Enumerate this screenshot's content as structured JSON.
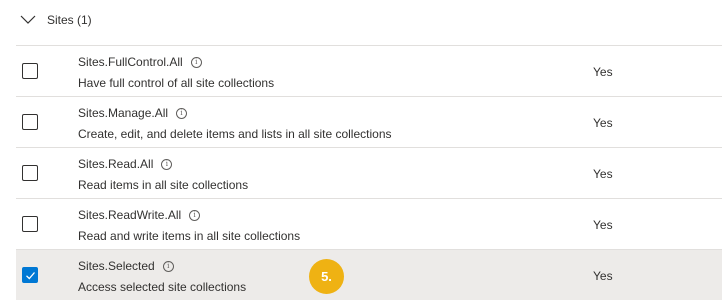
{
  "group": {
    "title": "Sites (1)"
  },
  "permissions": [
    {
      "name": "Sites.FullControl.All",
      "description": "Have full control of all site collections",
      "admin_consent": "Yes",
      "checked": false
    },
    {
      "name": "Sites.Manage.All",
      "description": "Create, edit, and delete items and lists in all site collections",
      "admin_consent": "Yes",
      "checked": false
    },
    {
      "name": "Sites.Read.All",
      "description": "Read items in all site collections",
      "admin_consent": "Yes",
      "checked": false
    },
    {
      "name": "Sites.ReadWrite.All",
      "description": "Read and write items in all site collections",
      "admin_consent": "Yes",
      "checked": false
    },
    {
      "name": "Sites.Selected",
      "description": "Access selected site collections",
      "admin_consent": "Yes",
      "checked": true
    }
  ],
  "step_badge": "5.",
  "icons": {
    "group_toggle": "chevron-down-icon",
    "info": "info-icon",
    "check": "checkmark-icon"
  },
  "colors": {
    "accent": "#0078d4",
    "selected_row": "#edebe9",
    "divider": "#e1dfdd",
    "step_badge": "#efb213"
  }
}
